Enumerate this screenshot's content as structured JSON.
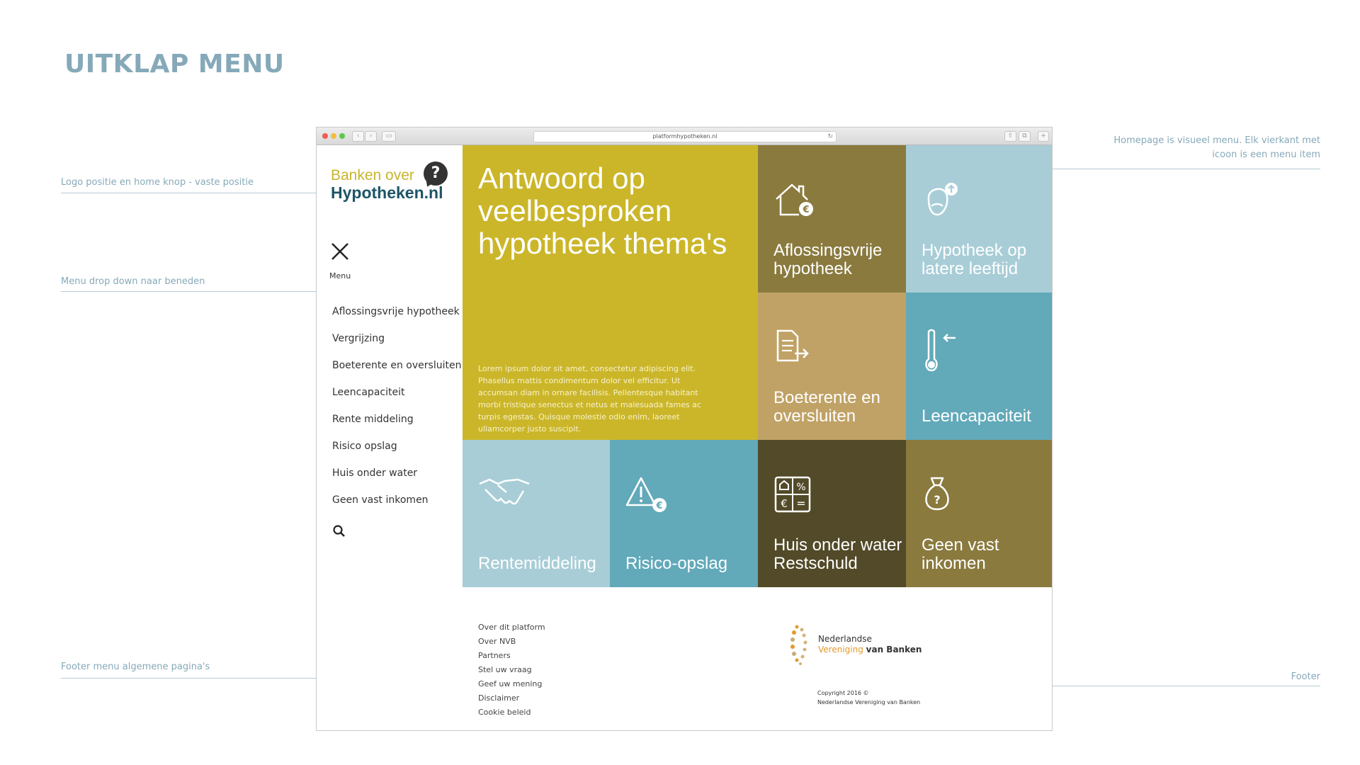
{
  "page": {
    "title": "UITKLAP MENU"
  },
  "annotations": {
    "logo": "Logo positie en home knop - vaste positie",
    "menu": "Menu drop down naar beneden",
    "footer_menu": "Footer menu algemene pagina's",
    "homepage": "Homepage is visueel menu. Elk vierkant met icoon is een menu item",
    "footer": "Footer"
  },
  "browser": {
    "url": "platformhypotheken.nl"
  },
  "colors": {
    "hero": "#cbb62a",
    "olive": "#8a7a3e",
    "lightblue": "#a8cdd7",
    "tan": "#c0a266",
    "teal": "#62a9b9",
    "darkolive": "#524a28",
    "annotation": "#86a9b9"
  },
  "logo": {
    "line1": "Banken over",
    "line2": "Hypotheken.nl",
    "badge": "?"
  },
  "menu": {
    "label": "Menu",
    "items": [
      "Aflossingsvrije hypotheek",
      "Vergrijzing",
      "Boeterente en oversluiten",
      "Leencapaciteit",
      "Rente middeling",
      "Risico opslag",
      "Huis onder water",
      "Geen vast inkomen"
    ]
  },
  "hero": {
    "title": "Antwoord op veelbesproken hypotheek thema's",
    "body": "Lorem ipsum dolor sit amet, consectetur adipiscing elit. Phasellus mattis condimentum dolor vel efficitur. Ut accumsan diam in ornare facilisis. Pellentesque habitant morbi tristique senectus et netus et malesuada fames ac turpis egestas. Quisque molestie odio enim, laoreet ullamcorper justo suscipit."
  },
  "tiles": [
    {
      "label": "Aflossingsvrije hypotheek",
      "icon": "house-euro-icon"
    },
    {
      "label": "Hypotheek op latere leeftijd",
      "icon": "elderly-man-icon"
    },
    {
      "label": "Boeterente en oversluiten",
      "icon": "document-arrow-icon"
    },
    {
      "label": "Leencapaciteit",
      "icon": "thermometer-euro-icon"
    },
    {
      "label": "Rentemiddeling",
      "icon": "handshake-icon"
    },
    {
      "label": "Risico-opslag",
      "icon": "warning-euro-icon"
    },
    {
      "label": "Huis onder water Restschuld",
      "icon": "calculator-icon"
    },
    {
      "label": "Geen vast inkomen",
      "icon": "money-bag-icon"
    }
  ],
  "footer": {
    "links": [
      "Over dit platform",
      "Over NVB",
      "Partners",
      "Stel uw vraag",
      "Geef uw mening",
      "Disclaimer",
      "Cookie beleid"
    ],
    "nvb_line1": "Nederlandse",
    "nvb_line2a": "Vereniging",
    "nvb_line2b": "van Banken",
    "copyright_line1": "Copyright 2016 ©",
    "copyright_line2": "Nederlandse Vereniging van Banken"
  }
}
